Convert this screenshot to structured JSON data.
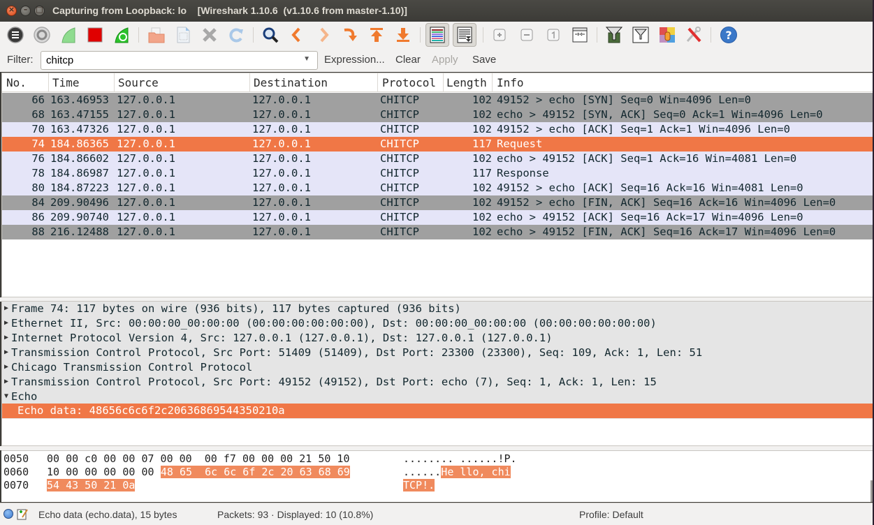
{
  "window": {
    "title": "Capturing from Loopback: lo    [Wireshark 1.10.6  (v1.10.6 from master-1.10)]",
    "close": "×",
    "minimize": "–",
    "maximize": "□"
  },
  "toolbar": {
    "buttons": [
      {
        "name": "interfaces-icon"
      },
      {
        "name": "capture-options-icon"
      },
      {
        "name": "start-capture-icon"
      },
      {
        "name": "stop-capture-icon"
      },
      {
        "name": "restart-capture-icon"
      },
      {
        "name": "open-file-icon"
      },
      {
        "name": "save-file-icon"
      },
      {
        "name": "close-file-icon"
      },
      {
        "name": "reload-icon"
      },
      {
        "name": "find-packet-icon"
      },
      {
        "name": "go-back-icon"
      },
      {
        "name": "go-forward-icon"
      },
      {
        "name": "go-to-packet-icon"
      },
      {
        "name": "go-first-icon"
      },
      {
        "name": "go-last-icon"
      },
      {
        "name": "colorize-icon"
      },
      {
        "name": "auto-scroll-icon"
      },
      {
        "name": "zoom-in-icon"
      },
      {
        "name": "zoom-out-icon"
      },
      {
        "name": "normal-size-icon"
      },
      {
        "name": "resize-columns-icon"
      },
      {
        "name": "capture-filters-icon"
      },
      {
        "name": "display-filters-icon"
      },
      {
        "name": "coloring-rules-icon"
      },
      {
        "name": "preferences-icon"
      },
      {
        "name": "help-icon"
      }
    ]
  },
  "filter": {
    "label": "Filter:",
    "value": "chitcp",
    "dropdown": "▼",
    "expression": "Expression...",
    "clear": "Clear",
    "apply": "Apply",
    "save": "Save"
  },
  "packet_list": {
    "columns": [
      "No.",
      "Time",
      "Source",
      "Destination",
      "Protocol",
      "Length",
      "Info"
    ],
    "rows": [
      {
        "no": "66",
        "time": "163.46953",
        "src": "127.0.0.1",
        "dst": "127.0.0.1",
        "proto": "CHITCP",
        "len": "102",
        "info": "49152 > echo [SYN] Seq=0 Win=4096 Len=0",
        "style": "gray"
      },
      {
        "no": "68",
        "time": "163.47155",
        "src": "127.0.0.1",
        "dst": "127.0.0.1",
        "proto": "CHITCP",
        "len": "102",
        "info": "echo > 49152 [SYN, ACK] Seq=0 Ack=1 Win=4096 Len=0",
        "style": "gray"
      },
      {
        "no": "70",
        "time": "163.47326",
        "src": "127.0.0.1",
        "dst": "127.0.0.1",
        "proto": "CHITCP",
        "len": "102",
        "info": "49152 > echo [ACK] Seq=1 Ack=1 Win=4096 Len=0",
        "style": "lav"
      },
      {
        "no": "74",
        "time": "184.86365",
        "src": "127.0.0.1",
        "dst": "127.0.0.1",
        "proto": "CHITCP",
        "len": "117",
        "info": "Request",
        "style": "sel"
      },
      {
        "no": "76",
        "time": "184.86602",
        "src": "127.0.0.1",
        "dst": "127.0.0.1",
        "proto": "CHITCP",
        "len": "102",
        "info": "echo > 49152 [ACK] Seq=1 Ack=16 Win=4081 Len=0",
        "style": "lav"
      },
      {
        "no": "78",
        "time": "184.86987",
        "src": "127.0.0.1",
        "dst": "127.0.0.1",
        "proto": "CHITCP",
        "len": "117",
        "info": "Response",
        "style": "lav"
      },
      {
        "no": "80",
        "time": "184.87223",
        "src": "127.0.0.1",
        "dst": "127.0.0.1",
        "proto": "CHITCP",
        "len": "102",
        "info": "49152 > echo [ACK] Seq=16 Ack=16 Win=4081 Len=0",
        "style": "lav"
      },
      {
        "no": "84",
        "time": "209.90496",
        "src": "127.0.0.1",
        "dst": "127.0.0.1",
        "proto": "CHITCP",
        "len": "102",
        "info": "49152 > echo [FIN, ACK] Seq=16 Ack=16 Win=4096 Len=0",
        "style": "gray"
      },
      {
        "no": "86",
        "time": "209.90740",
        "src": "127.0.0.1",
        "dst": "127.0.0.1",
        "proto": "CHITCP",
        "len": "102",
        "info": "echo > 49152 [ACK] Seq=16 Ack=17 Win=4096 Len=0",
        "style": "lav"
      },
      {
        "no": "88",
        "time": "216.12488",
        "src": "127.0.0.1",
        "dst": "127.0.0.1",
        "proto": "CHITCP",
        "len": "102",
        "info": "echo > 49152 [FIN, ACK] Seq=16 Ack=17 Win=4096 Len=0",
        "style": "gray"
      }
    ]
  },
  "details": {
    "lines": [
      {
        "arrow": "▶",
        "text": "Frame 74: 117 bytes on wire (936 bits), 117 bytes captured (936 bits)"
      },
      {
        "arrow": "▶",
        "text": "Ethernet II, Src: 00:00:00_00:00:00 (00:00:00:00:00:00), Dst: 00:00:00_00:00:00 (00:00:00:00:00:00)"
      },
      {
        "arrow": "▶",
        "text": "Internet Protocol Version 4, Src: 127.0.0.1 (127.0.0.1), Dst: 127.0.0.1 (127.0.0.1)"
      },
      {
        "arrow": "▶",
        "text": "Transmission Control Protocol, Src Port: 51409 (51409), Dst Port: 23300 (23300), Seq: 109, Ack: 1, Len: 51"
      },
      {
        "arrow": "▶",
        "text": "Chicago Transmission Control Protocol"
      },
      {
        "arrow": "▶",
        "text": "Transmission Control Protocol, Src Port: 49152 (49152), Dst Port: echo (7), Seq: 1, Ack: 1, Len: 15"
      },
      {
        "arrow": "▼",
        "text": "Echo"
      }
    ],
    "selected": "Echo data: 48656c6c6f2c20636869544350210a"
  },
  "bytes": {
    "lines": [
      {
        "offset": "0050",
        "hex_plain": "00 00 c0 00 00 07 00 00  00 f7 00 00 00 21 50 10",
        "hex_hl": "",
        "ascii_plain": "........ ......!P.",
        "ascii_hl": ""
      },
      {
        "offset": "0060",
        "hex_plain": "10 00 00 00 00 00 ",
        "hex_hl": "48 65  6c 6c 6f 2c 20 63 68 69",
        "ascii_plain": "......",
        "ascii_hl": "He llo, chi"
      },
      {
        "offset": "0070",
        "hex_plain": "",
        "hex_hl": "54 43 50 21 0a",
        "ascii_plain": "",
        "ascii_hl": "TCP!."
      }
    ]
  },
  "status": {
    "field": "Echo data (echo.data), 15 bytes",
    "packets": "Packets: 93 · Displayed: 10 (10.8%)",
    "profile": "Profile: Default"
  },
  "colors": {
    "selected": "#f07746",
    "gray_row": "#a0a0a0",
    "lavender_row": "#e5e5f8",
    "bytes_highlight": "#f08a5d"
  }
}
